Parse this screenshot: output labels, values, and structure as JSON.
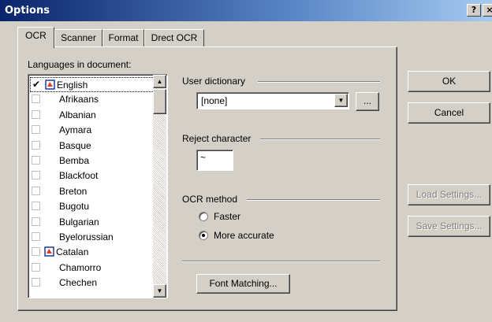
{
  "window": {
    "title": "Options",
    "help_button": "?",
    "close_button": "×"
  },
  "tabs": [
    {
      "label": "OCR",
      "active": true
    },
    {
      "label": "Scanner",
      "active": false
    },
    {
      "label": "Format",
      "active": false
    },
    {
      "label": "Drect OCR",
      "active": false
    }
  ],
  "languages": {
    "label": "Languages in document:",
    "items": [
      {
        "name": "English",
        "checked": true,
        "has_dictionary": true
      },
      {
        "name": "Afrikaans",
        "checked": false,
        "has_dictionary": false
      },
      {
        "name": "Albanian",
        "checked": false,
        "has_dictionary": false
      },
      {
        "name": "Aymara",
        "checked": false,
        "has_dictionary": false
      },
      {
        "name": "Basque",
        "checked": false,
        "has_dictionary": false
      },
      {
        "name": "Bemba",
        "checked": false,
        "has_dictionary": false
      },
      {
        "name": "Blackfoot",
        "checked": false,
        "has_dictionary": false
      },
      {
        "name": "Breton",
        "checked": false,
        "has_dictionary": false
      },
      {
        "name": "Bugotu",
        "checked": false,
        "has_dictionary": false
      },
      {
        "name": "Bulgarian",
        "checked": false,
        "has_dictionary": false
      },
      {
        "name": "Byelorussian",
        "checked": false,
        "has_dictionary": false
      },
      {
        "name": "Catalan",
        "checked": false,
        "has_dictionary": true
      },
      {
        "name": "Chamorro",
        "checked": false,
        "has_dictionary": false
      },
      {
        "name": "Chechen",
        "checked": false,
        "has_dictionary": false
      }
    ]
  },
  "user_dictionary": {
    "label": "User dictionary",
    "value": "[none]",
    "browse_label": "..."
  },
  "reject_character": {
    "label": "Reject character",
    "value": "~"
  },
  "ocr_method": {
    "label": "OCR method",
    "options": [
      {
        "label": "Faster",
        "selected": false
      },
      {
        "label": "More accurate",
        "selected": true
      }
    ]
  },
  "font_matching_label": "Font Matching...",
  "buttons": {
    "ok": "OK",
    "cancel": "Cancel",
    "load": "Load Settings...",
    "save": "Save Settings..."
  },
  "colors": {
    "titlebar_start": "#0a246a",
    "titlebar_end": "#a6caf0",
    "face": "#d4d0c8"
  },
  "icons": {
    "checkmark": "✔",
    "scroll_up": "▲",
    "scroll_down": "▼",
    "combo_arrow": "▼"
  }
}
